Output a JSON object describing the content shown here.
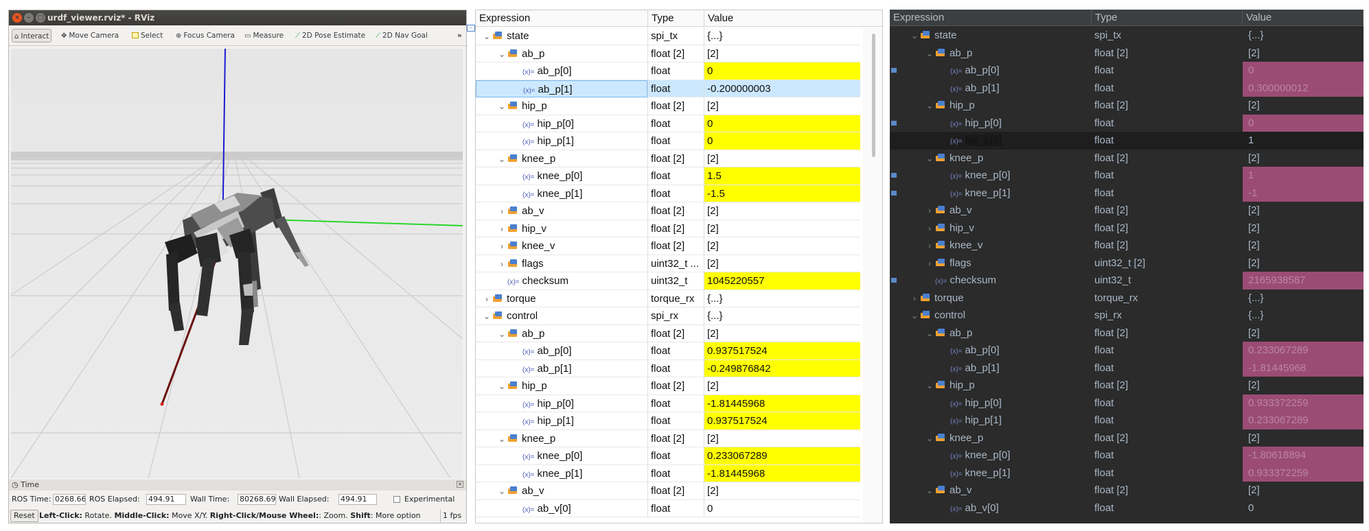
{
  "rviz": {
    "title": "urdf_viewer.rviz* - RViz",
    "toolbar": {
      "interact": "Interact",
      "move_camera": "Move Camera",
      "select": "Select",
      "focus_camera": "Focus Camera",
      "measure": "Measure",
      "pose_estimate": "2D Pose Estimate",
      "nav_goal": "2D Nav Goal",
      "overflow": "»"
    },
    "time_panel": {
      "header": "Time",
      "ros_time_label": "ROS Time:",
      "ros_time": "0268.66",
      "ros_elapsed_label": "ROS Elapsed:",
      "ros_elapsed": "494.91",
      "wall_time_label": "Wall Time:",
      "wall_time": "80268.69",
      "wall_elapsed_label": "Wall Elapsed:",
      "wall_elapsed": "494.91",
      "experimental": "Experimental"
    },
    "status": {
      "reset": "Reset",
      "k1": "Left-Click:",
      "t1": " Rotate. ",
      "k2": "Middle-Click:",
      "t2": " Move X/Y. ",
      "k3": "Right-Click/Mouse Wheel:",
      "t3": ": Zoom. ",
      "k4": "Shift",
      "t4": ": More option",
      "fps": "1 fps"
    },
    "colors": {
      "x_axis": "#2ad62a",
      "y_axis": "#1a1ad0",
      "z_axis": "#7a0f0f"
    }
  },
  "light_table": {
    "headers": {
      "expression": "Expression",
      "type": "Type",
      "value": "Value"
    },
    "rows": [
      {
        "depth": 0,
        "tw": "v",
        "kind": "struct",
        "name": "state",
        "type": "spi_tx",
        "value": "{...}",
        "hl": false
      },
      {
        "depth": 1,
        "tw": "v",
        "kind": "struct",
        "name": "ab_p",
        "type": "float [2]",
        "value": "[2]",
        "hl": false
      },
      {
        "depth": 2,
        "tw": "",
        "kind": "var",
        "name": "ab_p[0]",
        "type": "float",
        "value": "0",
        "hl": true
      },
      {
        "depth": 2,
        "tw": "",
        "kind": "var",
        "name": "ab_p[1]",
        "type": "float",
        "value": "-0.200000003",
        "hl": false,
        "sel": true
      },
      {
        "depth": 1,
        "tw": "v",
        "kind": "struct",
        "name": "hip_p",
        "type": "float [2]",
        "value": "[2]",
        "hl": false
      },
      {
        "depth": 2,
        "tw": "",
        "kind": "var",
        "name": "hip_p[0]",
        "type": "float",
        "value": "0",
        "hl": true
      },
      {
        "depth": 2,
        "tw": "",
        "kind": "var",
        "name": "hip_p[1]",
        "type": "float",
        "value": "0",
        "hl": true
      },
      {
        "depth": 1,
        "tw": "v",
        "kind": "struct",
        "name": "knee_p",
        "type": "float [2]",
        "value": "[2]",
        "hl": false
      },
      {
        "depth": 2,
        "tw": "",
        "kind": "var",
        "name": "knee_p[0]",
        "type": "float",
        "value": "1.5",
        "hl": true
      },
      {
        "depth": 2,
        "tw": "",
        "kind": "var",
        "name": "knee_p[1]",
        "type": "float",
        "value": "-1.5",
        "hl": true
      },
      {
        "depth": 1,
        "tw": ">",
        "kind": "struct",
        "name": "ab_v",
        "type": "float [2]",
        "value": "[2]",
        "hl": false
      },
      {
        "depth": 1,
        "tw": ">",
        "kind": "struct",
        "name": "hip_v",
        "type": "float [2]",
        "value": "[2]",
        "hl": false
      },
      {
        "depth": 1,
        "tw": ">",
        "kind": "struct",
        "name": "knee_v",
        "type": "float [2]",
        "value": "[2]",
        "hl": false
      },
      {
        "depth": 1,
        "tw": ">",
        "kind": "struct",
        "name": "flags",
        "type": "uint32_t ...",
        "value": "[2]",
        "hl": false
      },
      {
        "depth": 1,
        "tw": "",
        "kind": "var",
        "name": "checksum",
        "type": "uint32_t",
        "value": "1045220557",
        "hl": true
      },
      {
        "depth": 0,
        "tw": ">",
        "kind": "struct",
        "name": "torque",
        "type": "torque_rx",
        "value": "{...}",
        "hl": false
      },
      {
        "depth": 0,
        "tw": "v",
        "kind": "struct",
        "name": "control",
        "type": "spi_rx",
        "value": "{...}",
        "hl": false
      },
      {
        "depth": 1,
        "tw": "v",
        "kind": "struct",
        "name": "ab_p",
        "type": "float [2]",
        "value": "[2]",
        "hl": false
      },
      {
        "depth": 2,
        "tw": "",
        "kind": "var",
        "name": "ab_p[0]",
        "type": "float",
        "value": "0.937517524",
        "hl": true
      },
      {
        "depth": 2,
        "tw": "",
        "kind": "var",
        "name": "ab_p[1]",
        "type": "float",
        "value": "-0.249876842",
        "hl": true
      },
      {
        "depth": 1,
        "tw": "v",
        "kind": "struct",
        "name": "hip_p",
        "type": "float [2]",
        "value": "[2]",
        "hl": false
      },
      {
        "depth": 2,
        "tw": "",
        "kind": "var",
        "name": "hip_p[0]",
        "type": "float",
        "value": "-1.81445968",
        "hl": true
      },
      {
        "depth": 2,
        "tw": "",
        "kind": "var",
        "name": "hip_p[1]",
        "type": "float",
        "value": "0.937517524",
        "hl": true
      },
      {
        "depth": 1,
        "tw": "v",
        "kind": "struct",
        "name": "knee_p",
        "type": "float [2]",
        "value": "[2]",
        "hl": false
      },
      {
        "depth": 2,
        "tw": "",
        "kind": "var",
        "name": "knee_p[0]",
        "type": "float",
        "value": "0.233067289",
        "hl": true
      },
      {
        "depth": 2,
        "tw": "",
        "kind": "var",
        "name": "knee_p[1]",
        "type": "float",
        "value": "-1.81445968",
        "hl": true
      },
      {
        "depth": 1,
        "tw": "v",
        "kind": "struct",
        "name": "ab_v",
        "type": "float [2]",
        "value": "[2]",
        "hl": false
      },
      {
        "depth": 2,
        "tw": "",
        "kind": "var",
        "name": "ab_v[0]",
        "type": "float",
        "value": "0",
        "hl": false
      }
    ]
  },
  "dark_table": {
    "headers": {
      "expression": "Expression",
      "type": "Type",
      "value": "Value"
    },
    "rows": [
      {
        "depth": 0,
        "tw": "v",
        "kind": "struct",
        "name": "state",
        "type": "spi_tx",
        "value": "{...}",
        "hl": false
      },
      {
        "depth": 1,
        "tw": "v",
        "kind": "struct",
        "name": "ab_p",
        "type": "float [2]",
        "value": "[2]",
        "hl": false
      },
      {
        "depth": 2,
        "tw": "",
        "kind": "var",
        "name": "ab_p[0]",
        "type": "float",
        "value": "0",
        "hl": true
      },
      {
        "depth": 2,
        "tw": "",
        "kind": "var",
        "name": "ab_p[1]",
        "type": "float",
        "value": "0.300000012",
        "hl": true
      },
      {
        "depth": 1,
        "tw": "v",
        "kind": "struct",
        "name": "hip_p",
        "type": "float [2]",
        "value": "[2]",
        "hl": false
      },
      {
        "depth": 2,
        "tw": "",
        "kind": "var",
        "name": "hip_p[0]",
        "type": "float",
        "value": "0",
        "hl": true
      },
      {
        "depth": 2,
        "tw": "",
        "kind": "var",
        "name": "hip_p[1]",
        "type": "float",
        "value": "1",
        "hl": false,
        "sel": true
      },
      {
        "depth": 1,
        "tw": "v",
        "kind": "struct",
        "name": "knee_p",
        "type": "float [2]",
        "value": "[2]",
        "hl": false
      },
      {
        "depth": 2,
        "tw": "",
        "kind": "var",
        "name": "knee_p[0]",
        "type": "float",
        "value": "1",
        "hl": true
      },
      {
        "depth": 2,
        "tw": "",
        "kind": "var",
        "name": "knee_p[1]",
        "type": "float",
        "value": "-1",
        "hl": true
      },
      {
        "depth": 1,
        "tw": ">",
        "kind": "struct",
        "name": "ab_v",
        "type": "float [2]",
        "value": "[2]",
        "hl": false
      },
      {
        "depth": 1,
        "tw": ">",
        "kind": "struct",
        "name": "hip_v",
        "type": "float [2]",
        "value": "[2]",
        "hl": false
      },
      {
        "depth": 1,
        "tw": ">",
        "kind": "struct",
        "name": "knee_v",
        "type": "float [2]",
        "value": "[2]",
        "hl": false
      },
      {
        "depth": 1,
        "tw": ">",
        "kind": "struct",
        "name": "flags",
        "type": "uint32_t [2]",
        "value": "[2]",
        "hl": false
      },
      {
        "depth": 1,
        "tw": "",
        "kind": "var",
        "name": "checksum",
        "type": "uint32_t",
        "value": "2165938587",
        "hl": true
      },
      {
        "depth": 0,
        "tw": ">",
        "kind": "struct",
        "name": "torque",
        "type": "torque_rx",
        "value": "{...}",
        "hl": false
      },
      {
        "depth": 0,
        "tw": "v",
        "kind": "struct",
        "name": "control",
        "type": "spi_rx",
        "value": "{...}",
        "hl": false
      },
      {
        "depth": 1,
        "tw": "v",
        "kind": "struct",
        "name": "ab_p",
        "type": "float [2]",
        "value": "[2]",
        "hl": false
      },
      {
        "depth": 2,
        "tw": "",
        "kind": "var",
        "name": "ab_p[0]",
        "type": "float",
        "value": "0.233067289",
        "hl": true
      },
      {
        "depth": 2,
        "tw": "",
        "kind": "var",
        "name": "ab_p[1]",
        "type": "float",
        "value": "-1.81445968",
        "hl": true
      },
      {
        "depth": 1,
        "tw": "v",
        "kind": "struct",
        "name": "hip_p",
        "type": "float [2]",
        "value": "[2]",
        "hl": false
      },
      {
        "depth": 2,
        "tw": "",
        "kind": "var",
        "name": "hip_p[0]",
        "type": "float",
        "value": "0.933372259",
        "hl": true
      },
      {
        "depth": 2,
        "tw": "",
        "kind": "var",
        "name": "hip_p[1]",
        "type": "float",
        "value": "0.233067289",
        "hl": true
      },
      {
        "depth": 1,
        "tw": "v",
        "kind": "struct",
        "name": "knee_p",
        "type": "float [2]",
        "value": "[2]",
        "hl": false
      },
      {
        "depth": 2,
        "tw": "",
        "kind": "var",
        "name": "knee_p[0]",
        "type": "float",
        "value": "-1.80618894",
        "hl": true
      },
      {
        "depth": 2,
        "tw": "",
        "kind": "var",
        "name": "knee_p[1]",
        "type": "float",
        "value": "0.933372259",
        "hl": true
      },
      {
        "depth": 1,
        "tw": "v",
        "kind": "struct",
        "name": "ab_v",
        "type": "float [2]",
        "value": "[2]",
        "hl": false
      },
      {
        "depth": 2,
        "tw": "",
        "kind": "var",
        "name": "ab_v[0]",
        "type": "float",
        "value": "0",
        "hl": false
      }
    ]
  }
}
